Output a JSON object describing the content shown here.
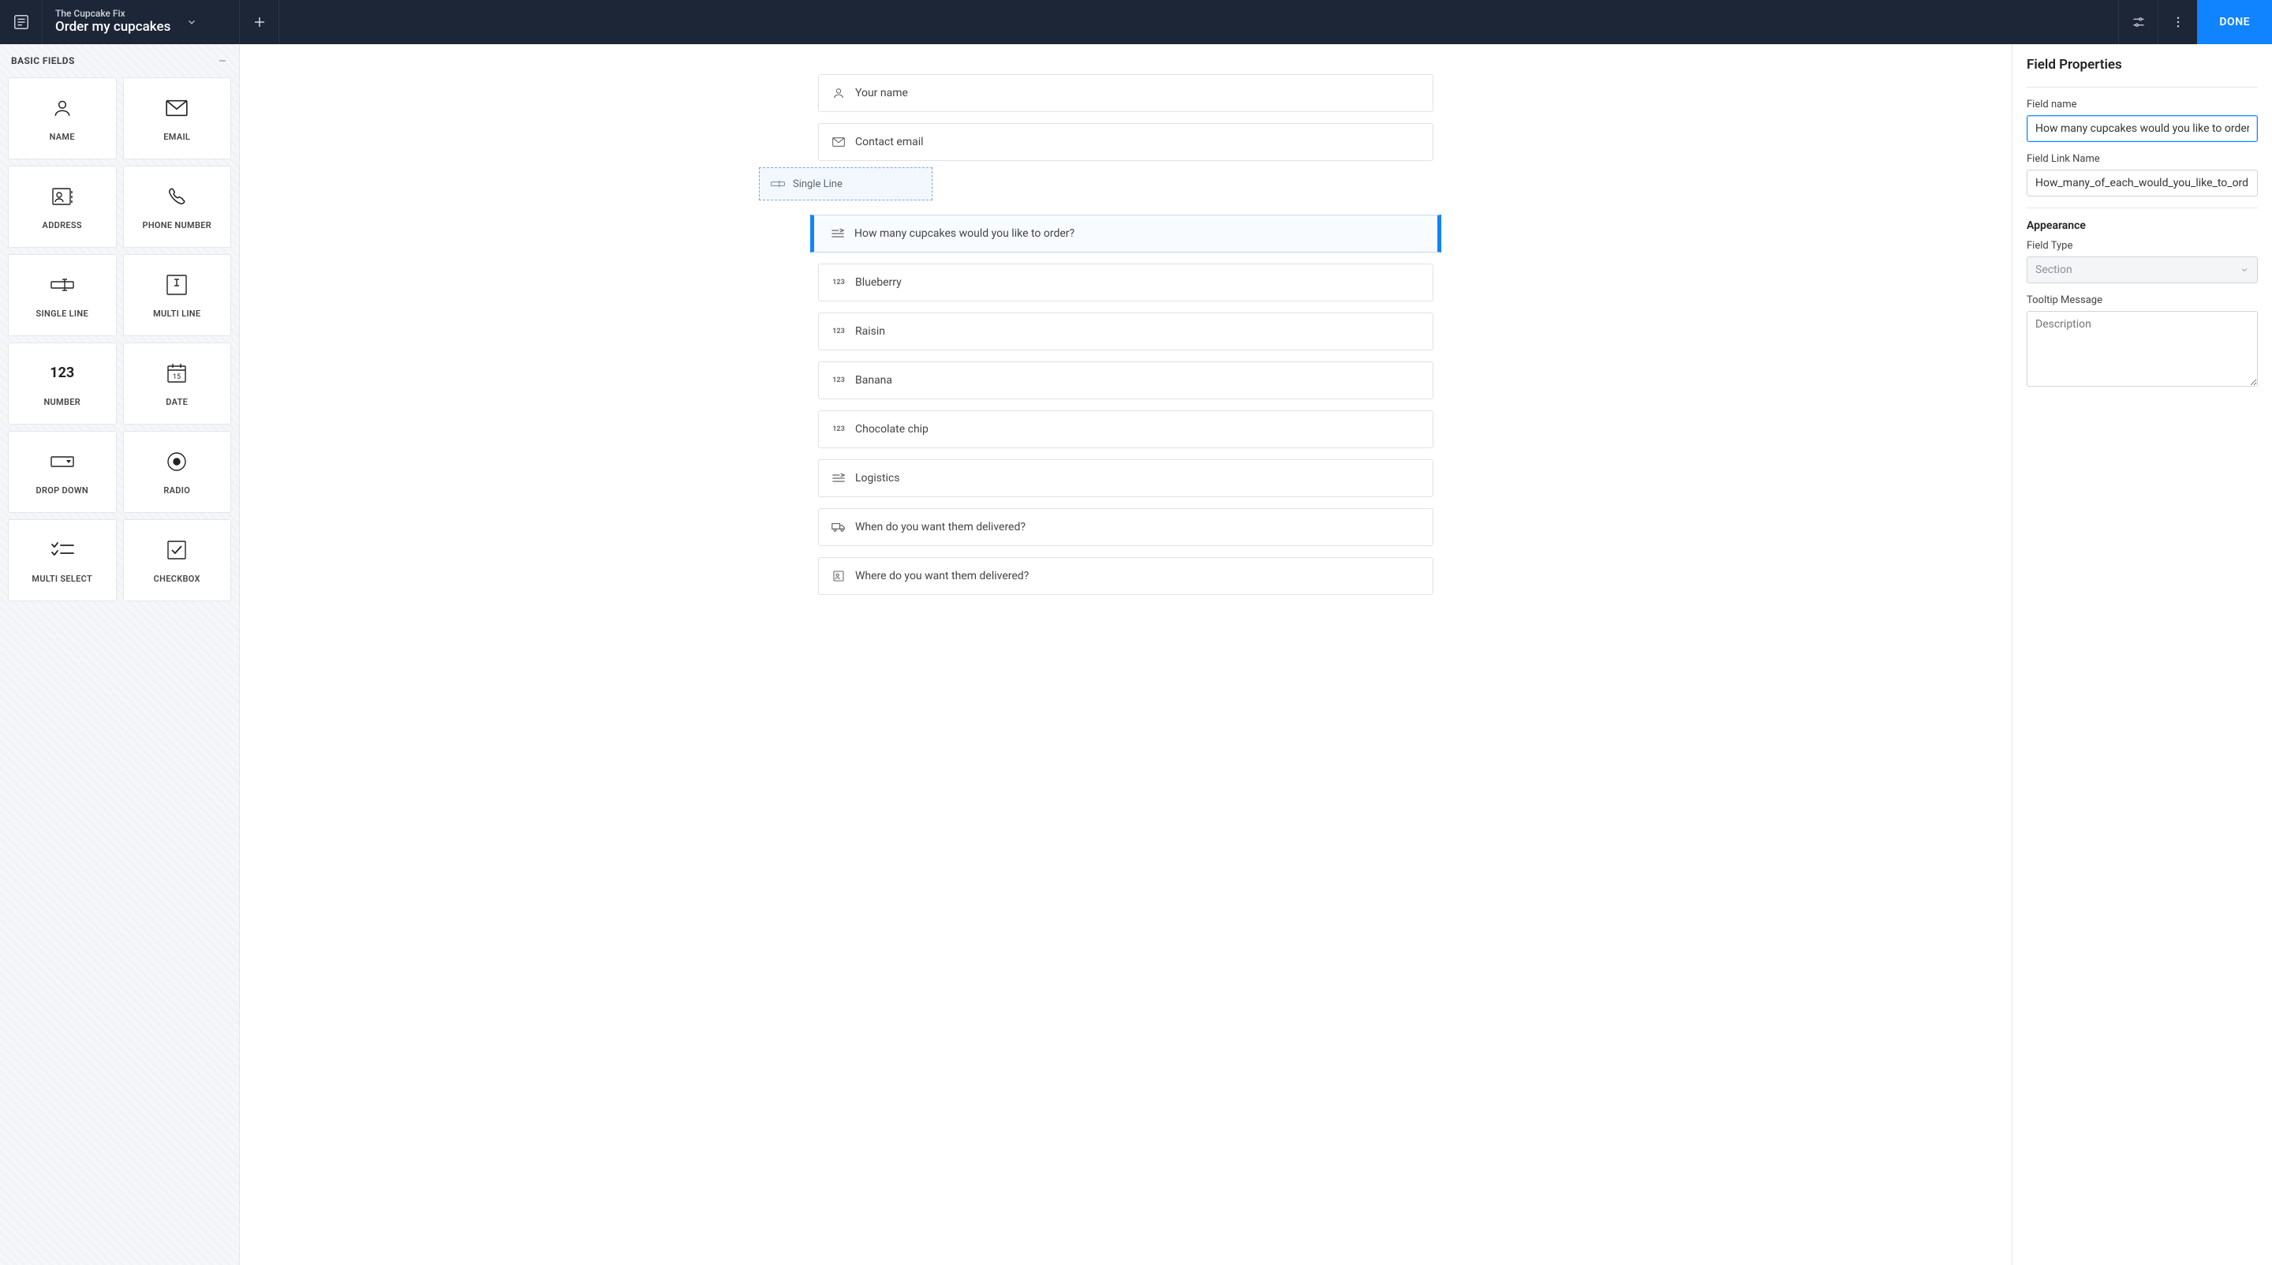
{
  "header": {
    "subtitle": "The Cupcake Fix",
    "title": "Order my cupcakes",
    "done_label": "DONE"
  },
  "sidebar": {
    "section_title": "BASIC FIELDS",
    "fields": [
      {
        "label": "NAME"
      },
      {
        "label": "EMAIL"
      },
      {
        "label": "ADDRESS"
      },
      {
        "label": "PHONE NUMBER"
      },
      {
        "label": "SINGLE LINE"
      },
      {
        "label": "MULTI LINE"
      },
      {
        "label": "NUMBER"
      },
      {
        "label": "DATE"
      },
      {
        "label": "DROP DOWN"
      },
      {
        "label": "RADIO"
      },
      {
        "label": "MULTI SELECT"
      },
      {
        "label": "CHECKBOX"
      }
    ],
    "number_glyph": "123",
    "date_glyph": "15"
  },
  "canvas": {
    "drop_label": "Single Line",
    "fields": [
      {
        "label": "Your name",
        "icon": "person"
      },
      {
        "label": "Contact email",
        "icon": "mail"
      },
      {
        "label": "How many cupcakes would you like to order?",
        "icon": "section",
        "selected": true
      },
      {
        "label": "Blueberry",
        "icon": "num"
      },
      {
        "label": "Raisin",
        "icon": "num"
      },
      {
        "label": "Banana",
        "icon": "num"
      },
      {
        "label": "Chocolate chip",
        "icon": "num"
      },
      {
        "label": "Logistics",
        "icon": "section"
      },
      {
        "label": "When do you want them delivered?",
        "icon": "truck"
      },
      {
        "label": "Where do you want them delivered?",
        "icon": "address"
      }
    ],
    "num_glyph": "123"
  },
  "props": {
    "panel_title": "Field Properties",
    "field_name_label": "Field name",
    "field_name_value": "How many cupcakes would you like to order?",
    "link_name_label": "Field Link Name",
    "link_name_value": "How_many_of_each_would_you_like_to_ord",
    "appearance_title": "Appearance",
    "field_type_label": "Field Type",
    "field_type_value": "Section",
    "tooltip_label": "Tooltip Message",
    "tooltip_placeholder": "Description"
  }
}
